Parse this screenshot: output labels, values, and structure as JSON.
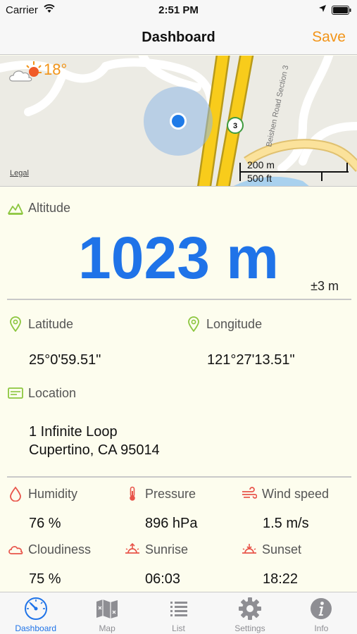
{
  "status_bar": {
    "carrier": "Carrier",
    "time": "2:51 PM"
  },
  "nav": {
    "title": "Dashboard",
    "save_label": "Save"
  },
  "map": {
    "temperature": "18°",
    "legal": "Legal",
    "road_label": "Beishen Road Section 3",
    "route_shield": "3",
    "scale_metric": "200 m",
    "scale_imperial": "500 ft"
  },
  "altitude": {
    "label": "Altitude",
    "value": "1023 m",
    "accuracy": "±3 m"
  },
  "coords": {
    "latitude_label": "Latitude",
    "latitude_value": "25°0'59.51\"",
    "longitude_label": "Longitude",
    "longitude_value": "121°27'13.51\""
  },
  "location": {
    "label": "Location",
    "line1": "1 Infinite Loop",
    "line2": "Cupertino, CA 95014"
  },
  "weather": {
    "humidity_label": "Humidity",
    "humidity_value": "76 %",
    "pressure_label": "Pressure",
    "pressure_value": "896 hPa",
    "wind_label": "Wind speed",
    "wind_value": "1.5 m/s",
    "cloudiness_label": "Cloudiness",
    "cloudiness_value": "75 %",
    "sunrise_label": "Sunrise",
    "sunrise_value": "06:03",
    "sunset_label": "Sunset",
    "sunset_value": "18:22"
  },
  "tabs": [
    {
      "label": "Dashboard",
      "icon": "speedometer-icon",
      "active": true
    },
    {
      "label": "Map",
      "icon": "map-icon",
      "active": false
    },
    {
      "label": "List",
      "icon": "list-icon",
      "active": false
    },
    {
      "label": "Settings",
      "icon": "gear-icon",
      "active": false
    },
    {
      "label": "Info",
      "icon": "info-icon",
      "active": false
    }
  ],
  "colors": {
    "accent_blue": "#1f73e8",
    "accent_orange": "#f29418",
    "icon_green": "#8cc63f",
    "icon_red": "#e8544a",
    "background": "#fdfdee"
  }
}
